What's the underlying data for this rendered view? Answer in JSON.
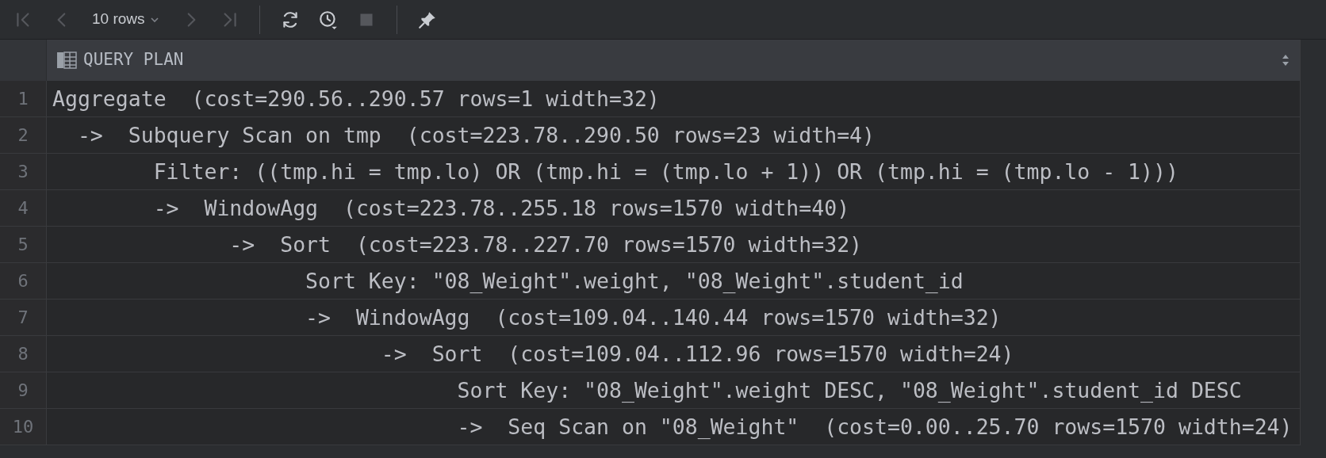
{
  "toolbar": {
    "items": [
      {
        "kind": "first",
        "disabled": true
      },
      {
        "kind": "prev",
        "disabled": true
      },
      {
        "kind": "pagesize",
        "label": "10 rows"
      },
      {
        "kind": "next",
        "disabled": true
      },
      {
        "kind": "last",
        "disabled": true
      },
      {
        "kind": "separator"
      },
      {
        "kind": "refresh",
        "disabled": false
      },
      {
        "kind": "history",
        "disabled": false
      },
      {
        "kind": "stop",
        "disabled": true
      },
      {
        "kind": "separator"
      },
      {
        "kind": "pin",
        "disabled": false
      }
    ]
  },
  "table": {
    "columns": [
      {
        "label": "QUERY PLAN"
      }
    ],
    "rows": [
      {
        "number": "1",
        "text": "Aggregate  (cost=290.56..290.57 rows=1 width=32)"
      },
      {
        "number": "2",
        "text": "  ->  Subquery Scan on tmp  (cost=223.78..290.50 rows=23 width=4)"
      },
      {
        "number": "3",
        "text": "        Filter: ((tmp.hi = tmp.lo) OR (tmp.hi = (tmp.lo + 1)) OR (tmp.hi = (tmp.lo - 1)))"
      },
      {
        "number": "4",
        "text": "        ->  WindowAgg  (cost=223.78..255.18 rows=1570 width=40)"
      },
      {
        "number": "5",
        "text": "              ->  Sort  (cost=223.78..227.70 rows=1570 width=32)"
      },
      {
        "number": "6",
        "text": "                    Sort Key: \"08_Weight\".weight, \"08_Weight\".student_id"
      },
      {
        "number": "7",
        "text": "                    ->  WindowAgg  (cost=109.04..140.44 rows=1570 width=32)"
      },
      {
        "number": "8",
        "text": "                          ->  Sort  (cost=109.04..112.96 rows=1570 width=24)"
      },
      {
        "number": "9",
        "text": "                                Sort Key: \"08_Weight\".weight DESC, \"08_Weight\".student_id DESC"
      },
      {
        "number": "10",
        "text": "                                ->  Seq Scan on \"08_Weight\"  (cost=0.00..25.70 rows=1570 width=24)"
      }
    ]
  }
}
